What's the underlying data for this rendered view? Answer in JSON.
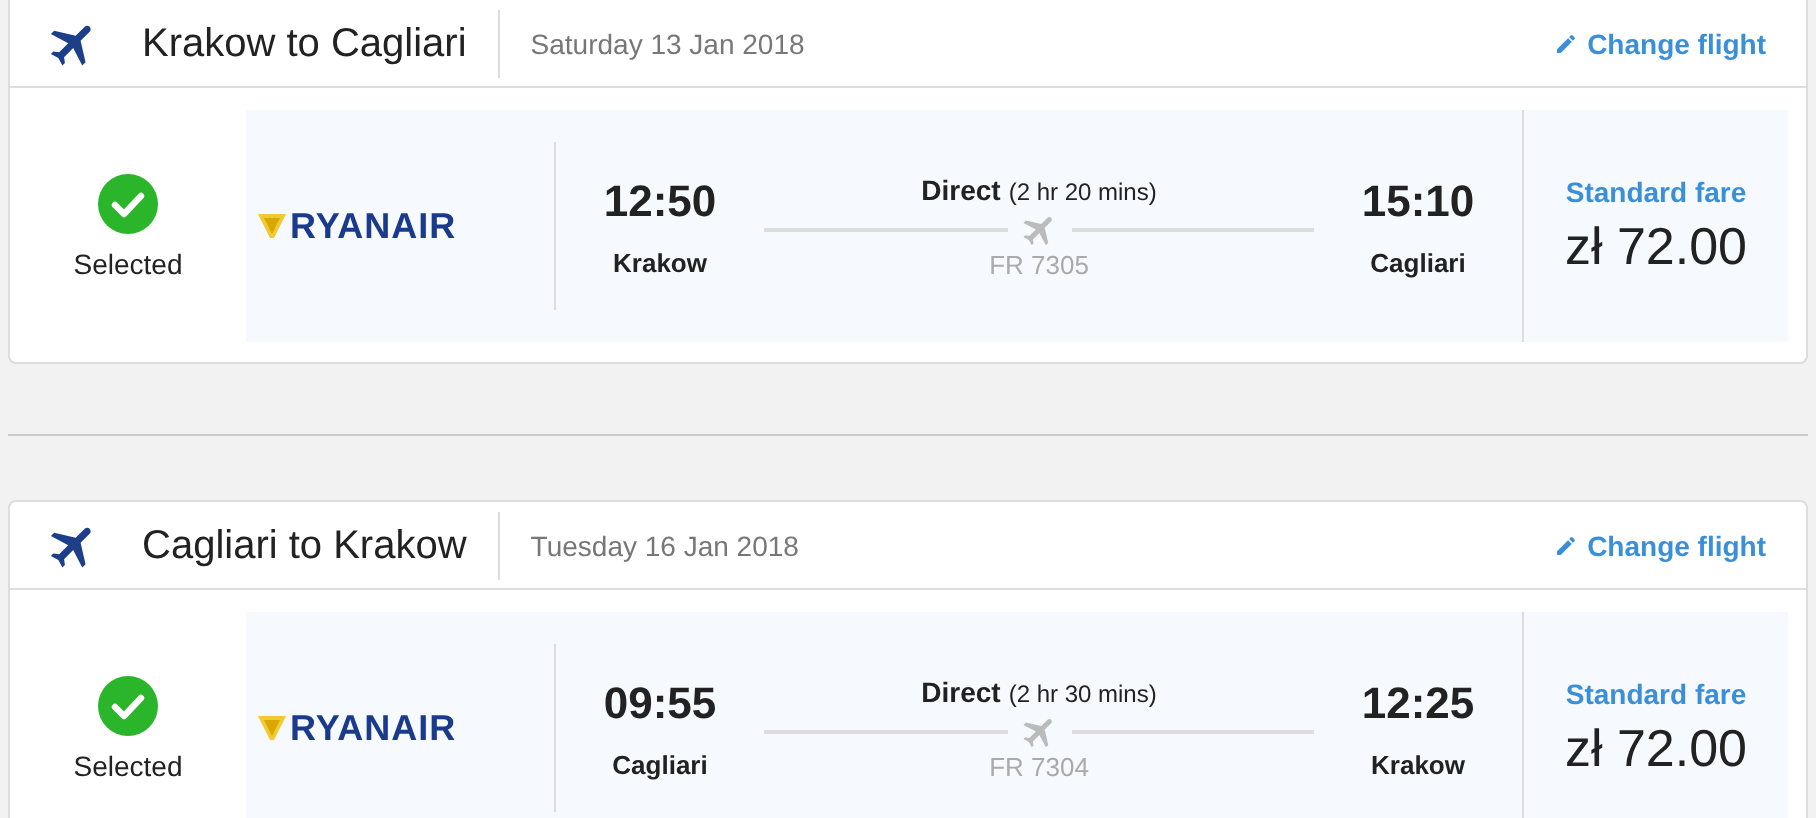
{
  "flights": [
    {
      "route": "Krakow to Cagliari",
      "date": "Saturday 13 Jan 2018",
      "change_label": "Change flight",
      "selected": true,
      "status": "Selected",
      "airline": "RYANAIR",
      "departure_time": "12:50",
      "departure_city": "Krakow",
      "stops": "Direct",
      "duration": "(2 hr 20 mins)",
      "flight_number": "FR 7305",
      "arrival_time": "15:10",
      "arrival_city": "Cagliari",
      "fare_name": "Standard fare",
      "price": "zł 72.00"
    },
    {
      "route": "Cagliari to Krakow",
      "date": "Tuesday 16 Jan 2018",
      "change_label": "Change flight",
      "selected": true,
      "status": "Selected",
      "airline": "RYANAIR",
      "departure_time": "09:55",
      "departure_city": "Cagliari",
      "stops": "Direct",
      "duration": "(2 hr 30 mins)",
      "flight_number": "FR 7304",
      "arrival_time": "12:25",
      "arrival_city": "Krakow",
      "fare_name": "Standard fare",
      "price": "zł 72.00"
    }
  ]
}
